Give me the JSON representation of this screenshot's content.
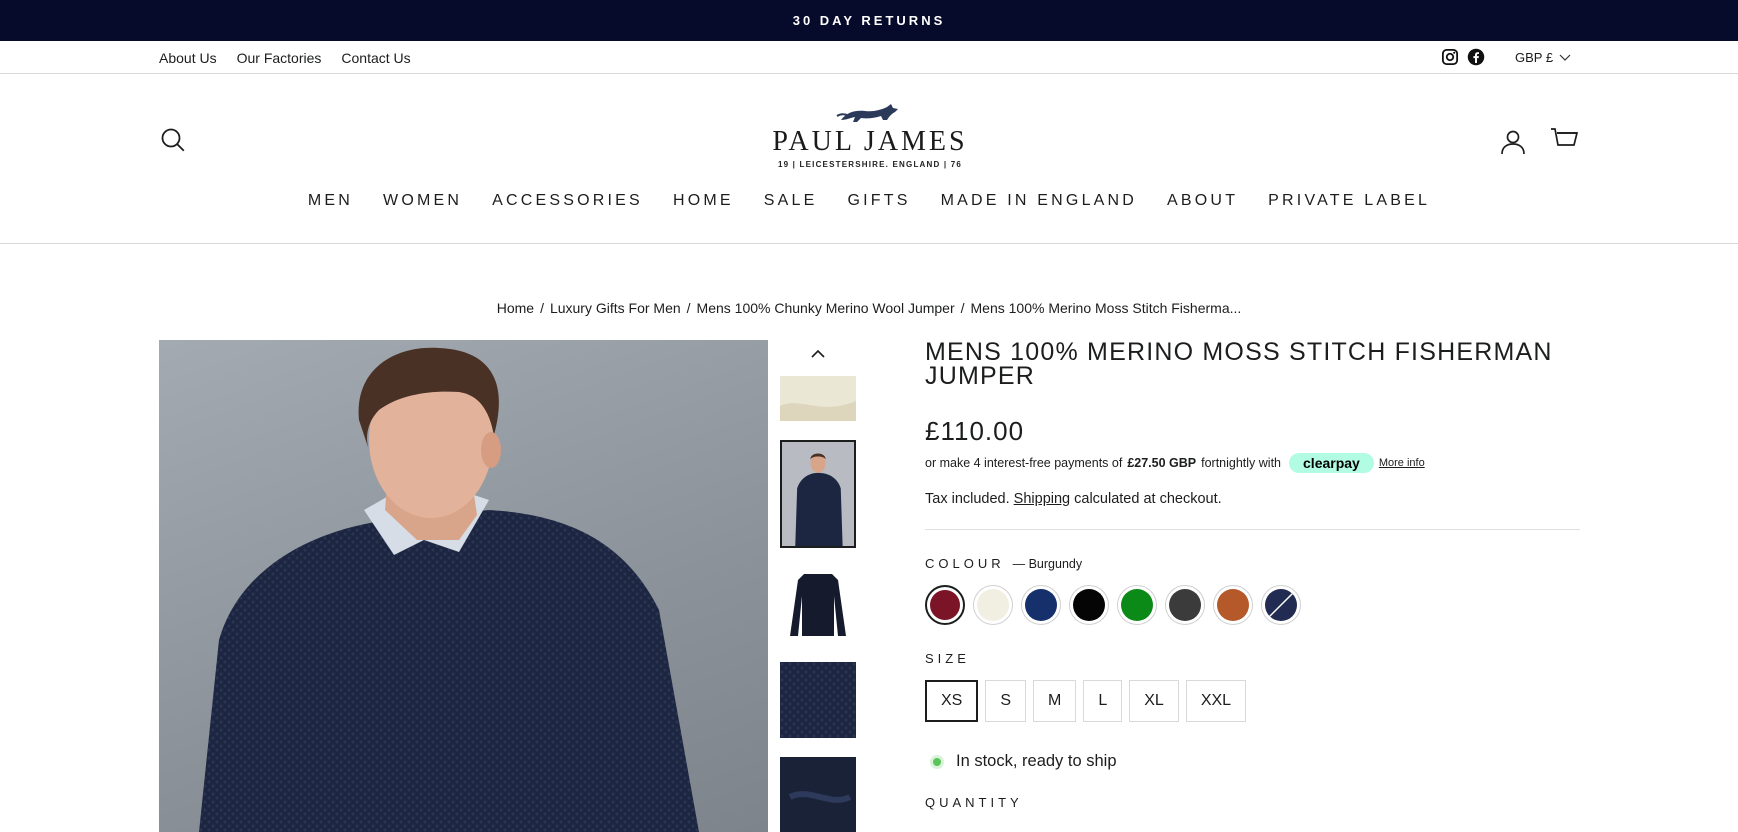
{
  "announcement": "30 DAY RETURNS",
  "utility": {
    "links": [
      "About Us",
      "Our Factories",
      "Contact Us"
    ],
    "currency": "GBP £"
  },
  "logo": {
    "name": "PAUL JAMES",
    "tagline": "19 | LEICESTERSHIRE. ENGLAND | 76"
  },
  "nav": [
    "MEN",
    "WOMEN",
    "ACCESSORIES",
    "HOME",
    "SALE",
    "GIFTS",
    "MADE IN ENGLAND",
    "ABOUT",
    "PRIVATE LABEL"
  ],
  "breadcrumb": [
    "Home",
    "Luxury Gifts For Men",
    "Mens 100% Chunky Merino Wool Jumper",
    "Mens 100% Merino Moss Stitch Fisherma..."
  ],
  "product": {
    "title": "Mens 100% Merino Moss Stitch Fisherman Jumper",
    "price": "£110.00",
    "clearpay": {
      "prefix": "or make 4 interest-free payments of",
      "amount": "£27.50 GBP",
      "suffix": "fortnightly with",
      "brand": "clearpay",
      "more": "More info"
    },
    "tax": {
      "prefix": "Tax included.",
      "link": "Shipping",
      "suffix": "calculated at checkout."
    },
    "colour_label": "COLOUR",
    "colour_selected": "— Burgundy",
    "colours": [
      "#7a1426",
      "#f1eee2",
      "#15306a",
      "#050505",
      "#0c8a17",
      "#3b3b3b",
      "#b5582a",
      "#222c52"
    ],
    "size_label": "SIZE",
    "sizes": [
      "XS",
      "S",
      "M",
      "L",
      "XL",
      "XXL"
    ],
    "stock": "In stock, ready to ship",
    "quantity_label": "QUANTITY"
  }
}
